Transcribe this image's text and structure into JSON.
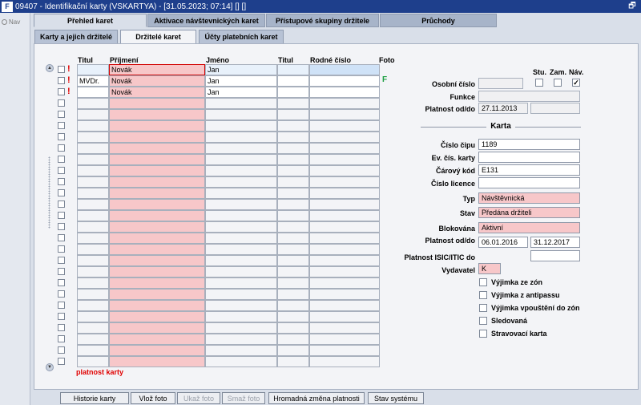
{
  "window": {
    "title": "09407 - Identifikační karty (VSKARTYA) - [31.05.2023; 07:14] [] []",
    "app_icon": "F",
    "restore_glyph": "🗗"
  },
  "nav": {
    "label": "Nav"
  },
  "tabs_top": [
    {
      "label": "Přehled karet",
      "active": true
    },
    {
      "label": "Aktivace návštevnických karet",
      "active": false
    },
    {
      "label": "Přístupové skupiny držitele",
      "active": false
    },
    {
      "label": "Průchody",
      "active": false
    }
  ],
  "tabs_sub": [
    {
      "label": "Karty a jejich držitelé",
      "active": false
    },
    {
      "label": "Držitelé karet",
      "active": true
    },
    {
      "label": "Účty platebních karet",
      "active": false
    }
  ],
  "grid": {
    "headers": {
      "titul": "Titul",
      "prijmeni": "Příjmení",
      "jmeno": "Jméno",
      "titul2": "Titul",
      "rodne_cislo": "Rodné číslo",
      "foto": "Foto"
    },
    "rows": [
      {
        "titul": "",
        "prijmeni": "Novák",
        "jmeno": "Jan",
        "titul2": "",
        "rodne": "",
        "mark": "!",
        "foto": ""
      },
      {
        "titul": "MVDr.",
        "prijmeni": "Novák",
        "jmeno": "Jan",
        "titul2": "",
        "rodne": "",
        "mark": "!",
        "foto": "F"
      },
      {
        "titul": "",
        "prijmeni": "Novák",
        "jmeno": "Jan",
        "titul2": "",
        "rodne": "",
        "mark": "!",
        "foto": ""
      }
    ],
    "empty_row_count": 24,
    "legend": "platnost karty"
  },
  "detail": {
    "labels": {
      "osobni_cislo": "Osobní číslo",
      "stu": "Stu.",
      "zam": "Zam.",
      "nav": "Náv.",
      "funkce": "Funkce",
      "platnost": "Platnost od/do",
      "karta_section": "Karta",
      "cislo_cipu": "Číslo čipu",
      "ev_cis_karty": "Ev. čís. karty",
      "carovy_kod": "Čárový kód",
      "cislo_licence": "Číslo licence",
      "typ": "Typ",
      "stav": "Stav",
      "blokovana": "Blokována",
      "platnost_karty": "Platnost od/do",
      "platnost_isic": "Platnost ISIC/ITIC do",
      "vydavatel": "Vydavatel"
    },
    "values": {
      "osobni_cislo": "",
      "funkce": "",
      "platnost_od": "27.11.2013",
      "platnost_do": "",
      "cislo_cipu": "1189",
      "ev_cis_karty": "",
      "carovy_kod": "E131",
      "cislo_licence": "",
      "typ": "Návštěvnická",
      "stav": "Předána držiteli",
      "blokovana": "Aktivní",
      "karta_od": "06.01.2016",
      "karta_do": "31.12.2017",
      "platnost_isic": "",
      "vydavatel": "K"
    },
    "flags": {
      "stu": false,
      "zam": false,
      "nav": true
    },
    "check_mark": "✓",
    "options": [
      {
        "label": "Výjimka ze zón",
        "checked": false
      },
      {
        "label": "Výjimka z antipassu",
        "checked": false
      },
      {
        "label": "Výjimka vpouštění do zón",
        "checked": false
      },
      {
        "label": "Sledovaná",
        "checked": false
      },
      {
        "label": "Stravovací karta",
        "checked": false
      }
    ]
  },
  "buttons": [
    {
      "label": "Historie karty",
      "enabled": true
    },
    {
      "label": "Vlož foto",
      "enabled": true
    },
    {
      "label": "Ukaž foto",
      "enabled": false
    },
    {
      "label": "Smaž foto",
      "enabled": false
    },
    {
      "label": "Hromadná změna platnosti",
      "enabled": true
    },
    {
      "label": "Stav systému",
      "enabled": true
    }
  ]
}
